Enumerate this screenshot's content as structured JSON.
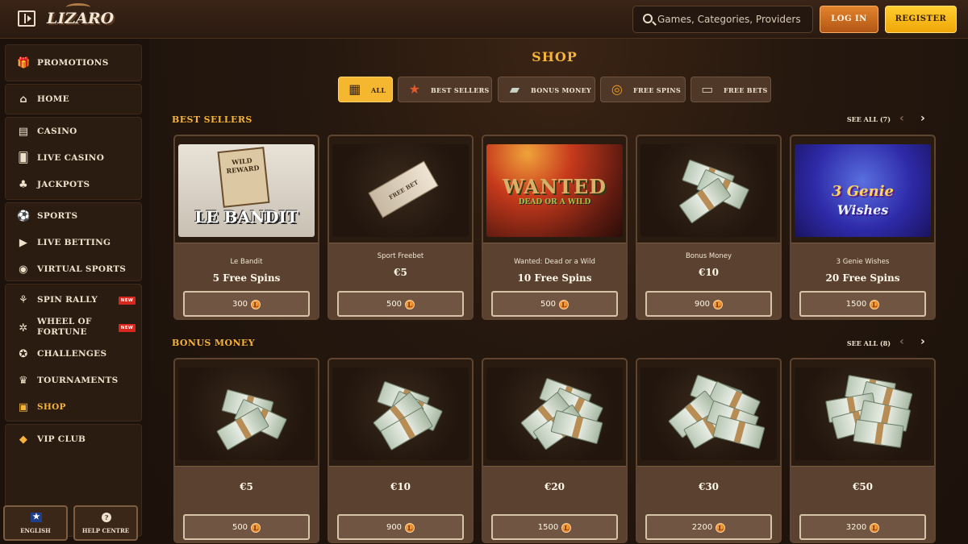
{
  "header": {
    "logo_text": "LIZARO",
    "search_placeholder": "Games, Categories, Providers",
    "login_label": "LOG IN",
    "register_label": "REGISTER"
  },
  "sidebar": {
    "items": [
      {
        "label": "PROMOTIONS",
        "icon": "gift-icon"
      },
      {
        "label": "HOME",
        "icon": "home-icon"
      },
      {
        "label": "CASINO",
        "icon": "slot-machine-icon"
      },
      {
        "label": "LIVE CASINO",
        "icon": "cards-icon"
      },
      {
        "label": "JACKPOTS",
        "icon": "clover-icon"
      },
      {
        "label": "SPORTS",
        "icon": "soccer-ball-icon"
      },
      {
        "label": "LIVE BETTING",
        "icon": "play-icon"
      },
      {
        "label": "VIRTUAL SPORTS",
        "icon": "virtual-sports-icon"
      },
      {
        "label": "SPIN RALLY",
        "icon": "spin-rally-icon",
        "badge": "NEW"
      },
      {
        "label": "WHEEL OF FORTUNE",
        "icon": "wheel-icon",
        "badge": "NEW"
      },
      {
        "label": "CHALLENGES",
        "icon": "medal-icon"
      },
      {
        "label": "TOURNAMENTS",
        "icon": "trophy-icon"
      },
      {
        "label": "SHOP",
        "icon": "shopping-bag-icon"
      },
      {
        "label": "VIP CLUB",
        "icon": "diamond-icon"
      }
    ],
    "language_label": "ENGLISH",
    "help_label": "HELP CENTRE"
  },
  "shop": {
    "title": "SHOP",
    "filters": [
      {
        "label": "ALL",
        "icon": "crate-icon"
      },
      {
        "label": "BEST SELLERS",
        "icon": "star-icon"
      },
      {
        "label": "BONUS MONEY",
        "icon": "cash-icon"
      },
      {
        "label": "FREE SPINS",
        "icon": "free-spin-icon"
      },
      {
        "label": "FREE BETS",
        "icon": "tickets-icon"
      }
    ],
    "best_sellers": {
      "title": "BEST SELLERS",
      "see_all": "SEE ALL (7)",
      "cards": [
        {
          "name": "Le Bandit",
          "value": "5 Free Spins",
          "price": "300",
          "art_title": "LE BANDIT",
          "art_sub": "WILD REWARD"
        },
        {
          "name": "Sport Freebet",
          "value": "€5",
          "price": "500",
          "art_title": "FREE BET"
        },
        {
          "name": "Wanted: Dead or a Wild",
          "value": "10 Free Spins",
          "price": "500",
          "art_title": "WANTED",
          "art_sub": "DEAD OR A WILD"
        },
        {
          "name": "Bonus Money",
          "value": "€10",
          "price": "900"
        },
        {
          "name": "3 Genie Wishes",
          "value": "20 Free Spins",
          "price": "1500",
          "art_title": "3 Genie",
          "art_sub": "Wishes"
        }
      ]
    },
    "bonus_money": {
      "title": "BONUS MONEY",
      "see_all": "SEE ALL (8)",
      "cards": [
        {
          "value": "€5",
          "price": "500"
        },
        {
          "value": "€10",
          "price": "900"
        },
        {
          "value": "€20",
          "price": "1500"
        },
        {
          "value": "€30",
          "price": "2200"
        },
        {
          "value": "€50",
          "price": "3200"
        }
      ]
    }
  },
  "colors": {
    "accent": "#f5b33a",
    "login": "#d7731f",
    "register": "#f8bd16",
    "new_badge": "#d8281e"
  }
}
